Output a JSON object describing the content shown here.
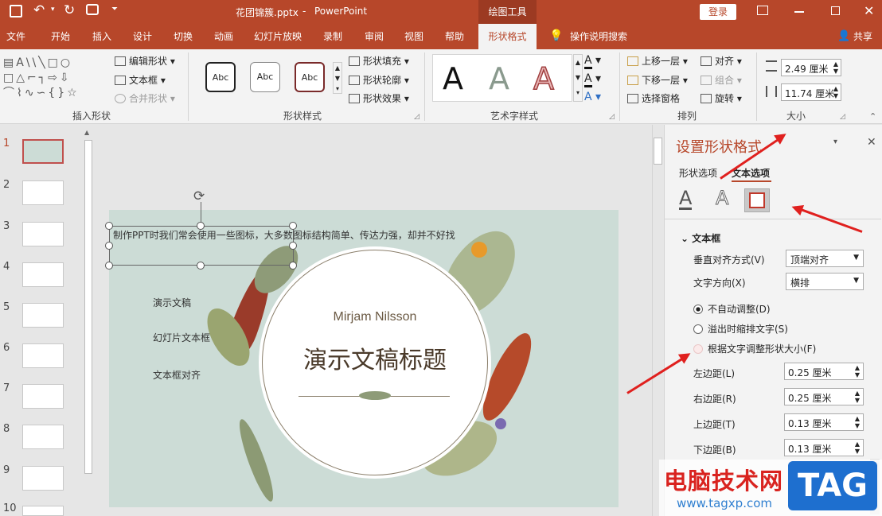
{
  "titlebar": {
    "filename": "花团锦簇.pptx",
    "app": "PowerPoint",
    "context_tool": "绘图工具",
    "login": "登录"
  },
  "tabs": [
    "文件",
    "开始",
    "插入",
    "设计",
    "切换",
    "动画",
    "幻灯片放映",
    "录制",
    "审阅",
    "视图",
    "帮助",
    "形状格式"
  ],
  "tell_me": "操作说明搜索",
  "share": "共享",
  "ribbon": {
    "insert_shape": {
      "label": "插入形状",
      "edit_shape": "编辑形状",
      "textbox": "文本框",
      "merge": "合并形状"
    },
    "shape_styles": {
      "label": "形状样式",
      "sample": "Abc",
      "fill": "形状填充",
      "outline": "形状轮廓",
      "effect": "形状效果"
    },
    "wordart": {
      "label": "艺术字样式",
      "sample": "A"
    },
    "arrange": {
      "label": "排列",
      "bring_forward": "上移一层",
      "send_backward": "下移一层",
      "selection_pane": "选择窗格",
      "align": "对齐",
      "group": "组合",
      "rotate": "旋转"
    },
    "size": {
      "label": "大小",
      "height": "2.49 厘米",
      "width": "11.74 厘米"
    }
  },
  "slides": [
    "1",
    "2",
    "3",
    "4",
    "5",
    "6",
    "7",
    "8",
    "9",
    "10"
  ],
  "slide": {
    "textbox_text": "制作PPT时我们常会使用一些图标，大多数图标结构简单、传达力强，却并不好找",
    "bullets": [
      "演示文稿",
      "幻灯片文本框",
      "文本框对齐"
    ],
    "author": "Mirjam Nilsson",
    "title": "演示文稿标题"
  },
  "pane": {
    "title": "设置形状格式",
    "tab_shape": "形状选项",
    "tab_text": "文本选项",
    "section": "文本框",
    "valign_label": "垂直对齐方式(V)",
    "valign_value": "顶端对齐",
    "direction_label": "文字方向(X)",
    "direction_value": "横排",
    "radio1": "不自动调整(D)",
    "radio2": "溢出时缩排文字(S)",
    "radio3": "根据文字调整形状大小(F)",
    "left_label": "左边距(L)",
    "left_value": "0.25 厘米",
    "right_label": "右边距(R)",
    "right_value": "0.25 厘米",
    "top_label": "上边距(T)",
    "top_value": "0.13 厘米",
    "bottom_label": "下边距(B)",
    "bottom_value": "0.13 厘米"
  },
  "watermark": {
    "site": "电脑技术网",
    "url": "www.tagxp.com",
    "logo": "TAG"
  },
  "colors": {
    "accent": "#b7472a",
    "arrow": "#e0201e"
  }
}
